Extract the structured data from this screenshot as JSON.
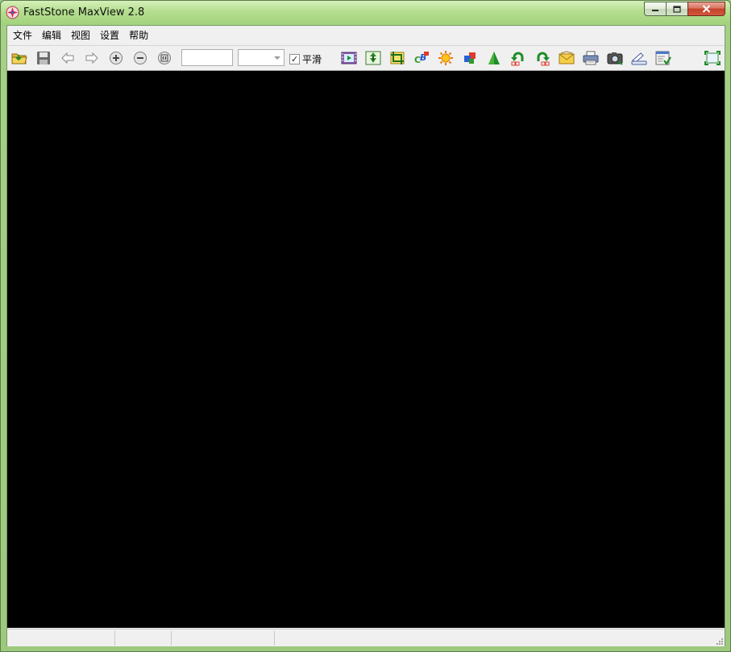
{
  "window": {
    "title": "FastStone MaxView 2.8",
    "accent_color": "#a6d086"
  },
  "menu": {
    "items": [
      "文件",
      "编辑",
      "视图",
      "设置",
      "帮助"
    ]
  },
  "toolbar": {
    "zoom_value": "",
    "zoom_dropdown_value": "",
    "smooth_label": "平滑",
    "smooth_checked": true,
    "icons": [
      "open-folder-icon",
      "save-icon",
      "previous-arrow-icon",
      "next-arrow-icon",
      "zoom-in-icon",
      "zoom-out-icon",
      "actual-size-icon",
      "slideshow-icon",
      "resize-icon",
      "crop-icon",
      "color-balance-icon",
      "brightness-icon",
      "color-adjust-icon",
      "sharpen-icon",
      "rotate-left-icon",
      "rotate-right-icon",
      "email-icon",
      "print-icon",
      "capture-icon",
      "scan-icon",
      "properties-icon",
      "fullscreen-icon"
    ]
  },
  "statusbar": {
    "panels": [
      "",
      "",
      "",
      ""
    ]
  }
}
